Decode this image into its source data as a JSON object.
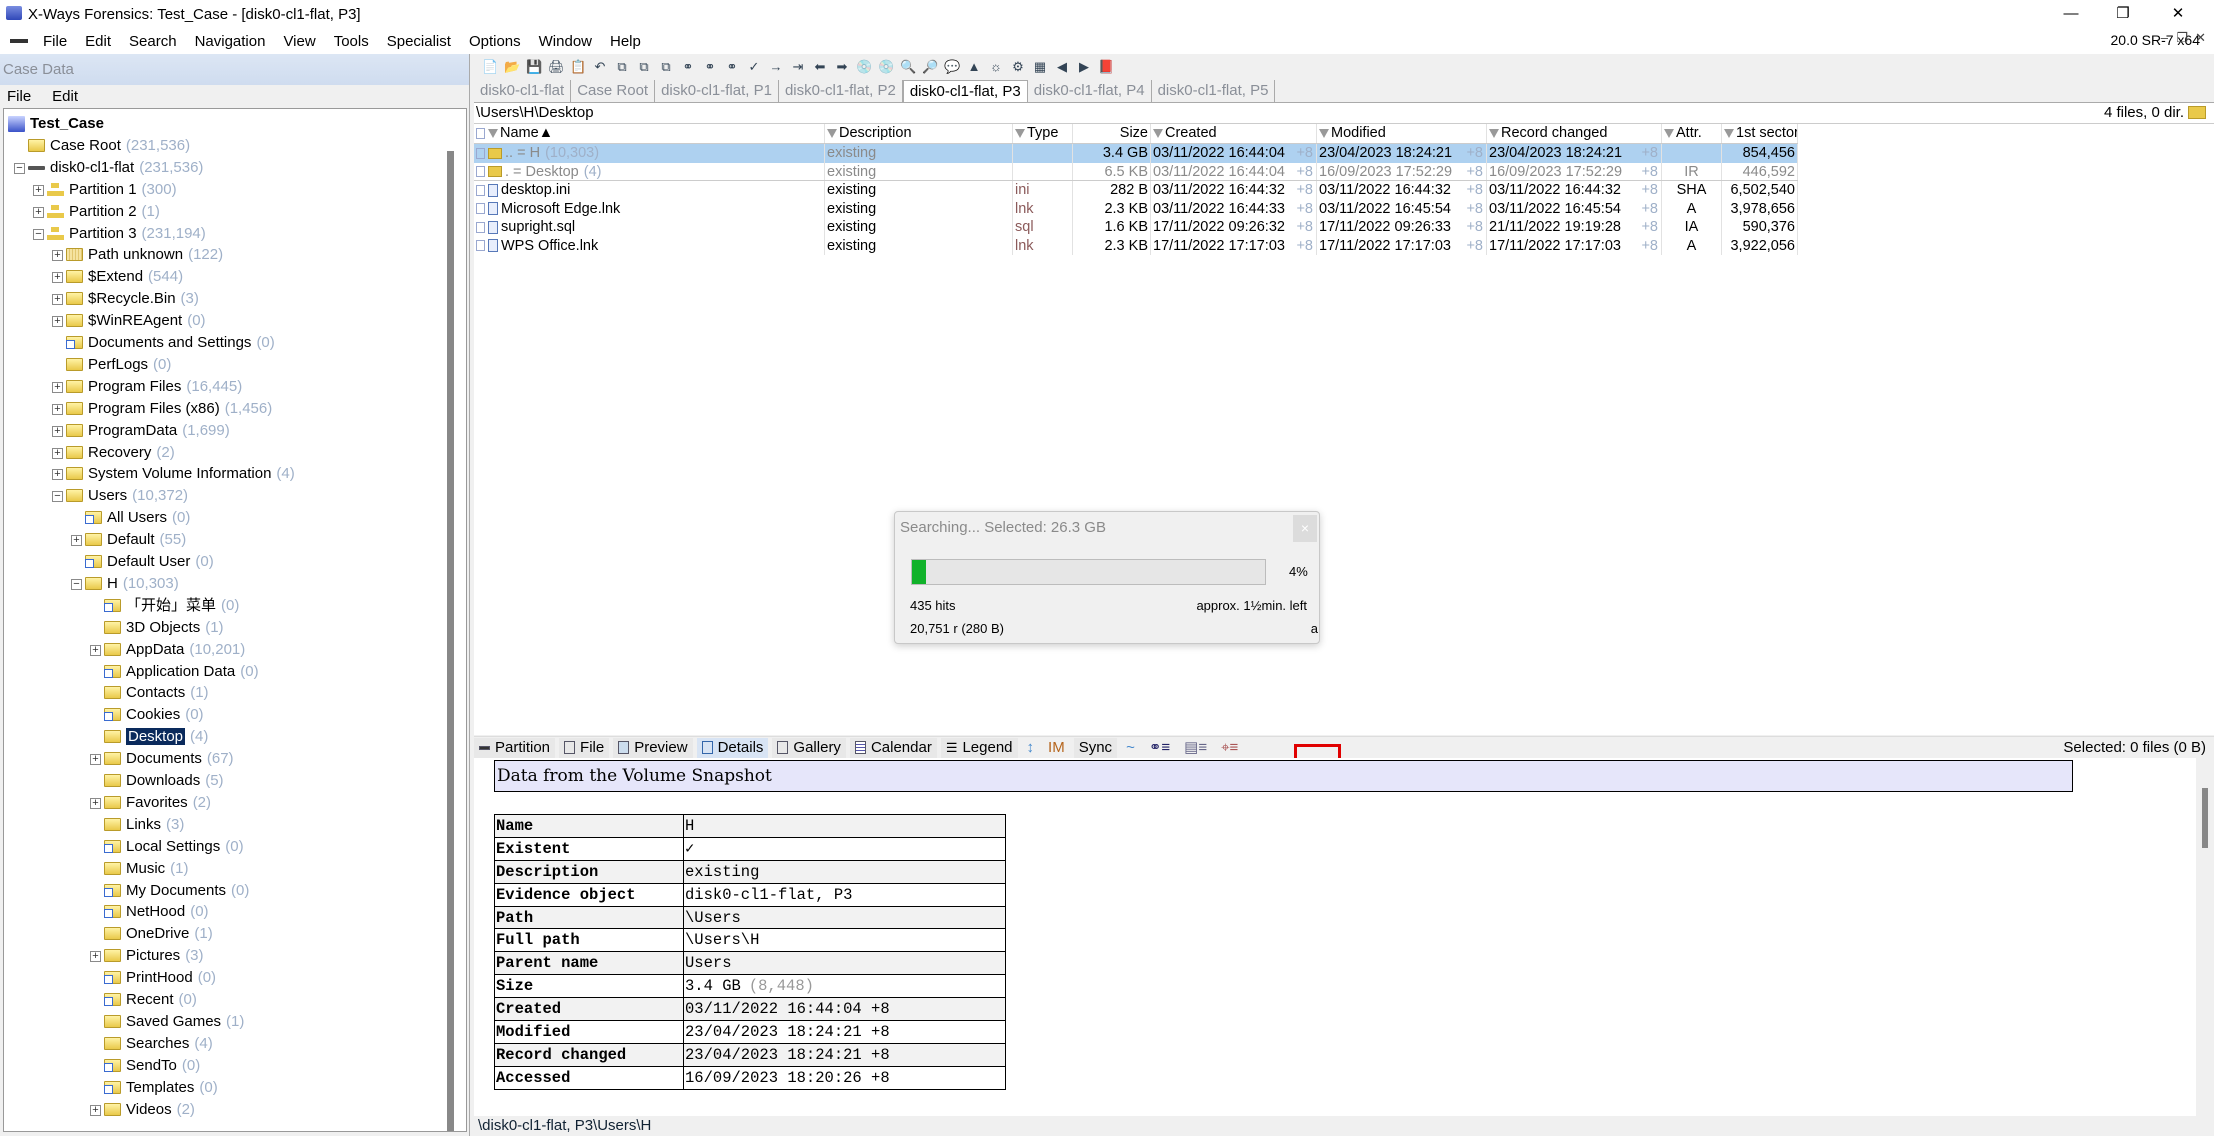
{
  "window": {
    "title": "X-Ways Forensics: Test_Case - [disk0-cl1-flat, P3]",
    "version": "20.0 SR-7 x64"
  },
  "menu": [
    "File",
    "Edit",
    "Search",
    "Navigation",
    "View",
    "Tools",
    "Specialist",
    "Options",
    "Window",
    "Help"
  ],
  "left_pane": {
    "header": "Case Data",
    "menu": [
      "File",
      "Edit"
    ],
    "tree": [
      {
        "label": "Test_Case",
        "count": "",
        "level": 0,
        "exp": "",
        "icon": "case",
        "bold": true
      },
      {
        "label": "Case Root",
        "count": "(231,536)",
        "level": 1,
        "exp": "",
        "icon": "folder"
      },
      {
        "label": "disk0-cl1-flat",
        "count": "(231,536)",
        "level": 1,
        "exp": "-",
        "icon": "disk"
      },
      {
        "label": "Partition 1",
        "count": "(300)",
        "level": 2,
        "exp": "+",
        "icon": "part"
      },
      {
        "label": "Partition 2",
        "count": "(1)",
        "level": 2,
        "exp": "+",
        "icon": "part"
      },
      {
        "label": "Partition 3",
        "count": "(231,194)",
        "level": 2,
        "exp": "-",
        "icon": "part"
      },
      {
        "label": "Path unknown",
        "count": "(122)",
        "level": 3,
        "exp": "+",
        "icon": "unk"
      },
      {
        "label": "$Extend",
        "count": "(544)",
        "level": 3,
        "exp": "+",
        "icon": "folder"
      },
      {
        "label": "$Recycle.Bin",
        "count": "(3)",
        "level": 3,
        "exp": "+",
        "icon": "folder"
      },
      {
        "label": "$WinREAgent",
        "count": "(0)",
        "level": 3,
        "exp": "+",
        "icon": "folder"
      },
      {
        "label": "Documents and Settings",
        "count": "(0)",
        "level": 3,
        "exp": "",
        "icon": "link"
      },
      {
        "label": "PerfLogs",
        "count": "(0)",
        "level": 3,
        "exp": "",
        "icon": "folder"
      },
      {
        "label": "Program Files",
        "count": "(16,445)",
        "level": 3,
        "exp": "+",
        "icon": "folder"
      },
      {
        "label": "Program Files (x86)",
        "count": "(1,456)",
        "level": 3,
        "exp": "+",
        "icon": "folder"
      },
      {
        "label": "ProgramData",
        "count": "(1,699)",
        "level": 3,
        "exp": "+",
        "icon": "folder"
      },
      {
        "label": "Recovery",
        "count": "(2)",
        "level": 3,
        "exp": "+",
        "icon": "folder"
      },
      {
        "label": "System Volume Information",
        "count": "(4)",
        "level": 3,
        "exp": "+",
        "icon": "folder"
      },
      {
        "label": "Users",
        "count": "(10,372)",
        "level": 3,
        "exp": "-",
        "icon": "folder"
      },
      {
        "label": "All Users",
        "count": "(0)",
        "level": 4,
        "exp": "",
        "icon": "link"
      },
      {
        "label": "Default",
        "count": "(55)",
        "level": 4,
        "exp": "+",
        "icon": "folder"
      },
      {
        "label": "Default User",
        "count": "(0)",
        "level": 4,
        "exp": "",
        "icon": "link"
      },
      {
        "label": "H",
        "count": "(10,303)",
        "level": 4,
        "exp": "-",
        "icon": "folder"
      },
      {
        "label": "「开始」菜单",
        "count": "(0)",
        "level": 5,
        "exp": "",
        "icon": "link"
      },
      {
        "label": "3D Objects",
        "count": "(1)",
        "level": 5,
        "exp": "",
        "icon": "folder"
      },
      {
        "label": "AppData",
        "count": "(10,201)",
        "level": 5,
        "exp": "+",
        "icon": "folder"
      },
      {
        "label": "Application Data",
        "count": "(0)",
        "level": 5,
        "exp": "",
        "icon": "link"
      },
      {
        "label": "Contacts",
        "count": "(1)",
        "level": 5,
        "exp": "",
        "icon": "folder"
      },
      {
        "label": "Cookies",
        "count": "(0)",
        "level": 5,
        "exp": "",
        "icon": "link"
      },
      {
        "label": "Desktop",
        "count": "(4)",
        "level": 5,
        "exp": "",
        "icon": "folder",
        "selected": true
      },
      {
        "label": "Documents",
        "count": "(67)",
        "level": 5,
        "exp": "+",
        "icon": "folder"
      },
      {
        "label": "Downloads",
        "count": "(5)",
        "level": 5,
        "exp": "",
        "icon": "folder"
      },
      {
        "label": "Favorites",
        "count": "(2)",
        "level": 5,
        "exp": "+",
        "icon": "folder"
      },
      {
        "label": "Links",
        "count": "(3)",
        "level": 5,
        "exp": "",
        "icon": "folder"
      },
      {
        "label": "Local Settings",
        "count": "(0)",
        "level": 5,
        "exp": "",
        "icon": "link"
      },
      {
        "label": "Music",
        "count": "(1)",
        "level": 5,
        "exp": "",
        "icon": "folder"
      },
      {
        "label": "My Documents",
        "count": "(0)",
        "level": 5,
        "exp": "",
        "icon": "link"
      },
      {
        "label": "NetHood",
        "count": "(0)",
        "level": 5,
        "exp": "",
        "icon": "link"
      },
      {
        "label": "OneDrive",
        "count": "(1)",
        "level": 5,
        "exp": "",
        "icon": "folder"
      },
      {
        "label": "Pictures",
        "count": "(3)",
        "level": 5,
        "exp": "+",
        "icon": "folder"
      },
      {
        "label": "PrintHood",
        "count": "(0)",
        "level": 5,
        "exp": "",
        "icon": "link"
      },
      {
        "label": "Recent",
        "count": "(0)",
        "level": 5,
        "exp": "",
        "icon": "link"
      },
      {
        "label": "Saved Games",
        "count": "(1)",
        "level": 5,
        "exp": "",
        "icon": "folder"
      },
      {
        "label": "Searches",
        "count": "(4)",
        "level": 5,
        "exp": "",
        "icon": "folder"
      },
      {
        "label": "SendTo",
        "count": "(0)",
        "level": 5,
        "exp": "",
        "icon": "link"
      },
      {
        "label": "Templates",
        "count": "(0)",
        "level": 5,
        "exp": "",
        "icon": "link"
      },
      {
        "label": "Videos",
        "count": "(2)",
        "level": 5,
        "exp": "+",
        "icon": "folder"
      }
    ]
  },
  "tabs": [
    "disk0-cl1-flat",
    "Case Root",
    "disk0-cl1-flat, P1",
    "disk0-cl1-flat, P2",
    "disk0-cl1-flat, P3",
    "disk0-cl1-flat, P4",
    "disk0-cl1-flat, P5"
  ],
  "active_tab": 4,
  "path": "\\Users\\H\\Desktop",
  "file_count": "4 files, 0 dir.",
  "columns": [
    "Name",
    "Description",
    "Type",
    "Size",
    "Created",
    "Modified",
    "Record changed",
    "Attr.",
    "1st sector"
  ],
  "files": [
    {
      "name": "..  =  H",
      "count": "(10,303)",
      "desc": "existing",
      "type": "",
      "size": "3.4 GB",
      "created": "03/11/2022  16:44:04",
      "modified": "23/04/2023  18:24:21",
      "record": "23/04/2023  18:24:21",
      "tz": "+8",
      "attr": "",
      "sector": "854,456",
      "kind": "parent",
      "selected": true
    },
    {
      "name": ".  =  Desktop",
      "count": "(4)",
      "desc": "existing",
      "type": "",
      "size": "6.5 KB",
      "created": "03/11/2022  16:44:04",
      "modified": "16/09/2023  17:52:29",
      "record": "16/09/2023  17:52:29",
      "tz": "+8",
      "attr": "IR",
      "sector": "446,592",
      "kind": "self"
    },
    {
      "name": "desktop.ini",
      "desc": "existing",
      "type": "ini",
      "size": "282 B",
      "created": "03/11/2022  16:44:32",
      "modified": "03/11/2022  16:44:32",
      "record": "03/11/2022  16:44:32",
      "tz": "+8",
      "attr": "SHA",
      "sector": "6,502,540",
      "kind": "file"
    },
    {
      "name": "Microsoft Edge.lnk",
      "desc": "existing",
      "type": "lnk",
      "size": "2.3 KB",
      "created": "03/11/2022  16:44:33",
      "modified": "03/11/2022  16:45:54",
      "record": "03/11/2022  16:45:54",
      "tz": "+8",
      "attr": "A",
      "sector": "3,978,656",
      "kind": "file"
    },
    {
      "name": "supright.sql",
      "desc": "existing",
      "type": "sql",
      "size": "1.6 KB",
      "created": "17/11/2022  09:26:32",
      "modified": "17/11/2022  09:26:33",
      "record": "21/11/2022  19:19:28",
      "tz": "+8",
      "attr": "IA",
      "sector": "590,376",
      "kind": "file"
    },
    {
      "name": "WPS Office.lnk",
      "desc": "existing",
      "type": "lnk",
      "size": "2.3 KB",
      "created": "17/11/2022  17:17:03",
      "modified": "17/11/2022  17:17:03",
      "record": "17/11/2022  17:17:03",
      "tz": "+8",
      "attr": "A",
      "sector": "3,922,056",
      "kind": "file"
    }
  ],
  "search_dialog": {
    "title": "Searching... Selected: 26.3 GB",
    "progress_percent": 4,
    "progress_label": "4%",
    "hits": "435 hits",
    "time_left": "approx. 1½min. left",
    "position": "20,751  r (280 B)",
    "trailing": "a",
    "close": "×",
    "bar_color": "#11b22a"
  },
  "bottom_toolbar": {
    "buttons": [
      "Partition",
      "File",
      "Preview",
      "Details",
      "Gallery",
      "Calendar",
      "Legend"
    ],
    "im": "IM",
    "sync": "Sync",
    "selected": "Selected: 0 files (0 B)"
  },
  "details": {
    "heading": "Data from the Volume Snapshot",
    "rows": [
      {
        "k": "Name",
        "v": "H"
      },
      {
        "k": "Existent",
        "v": "✓"
      },
      {
        "k": "Description",
        "v": "existing"
      },
      {
        "k": "Evidence object",
        "v": "disk0-cl1-flat, P3"
      },
      {
        "k": "Path",
        "v": "\\Users"
      },
      {
        "k": "Full path",
        "v": "\\Users\\H"
      },
      {
        "k": "Parent name",
        "v": "Users"
      },
      {
        "k": "Size",
        "v": "3.4 GB",
        "extra": "(8,448)"
      },
      {
        "k": "Created",
        "v": "03/11/2022   16:44:04   +8"
      },
      {
        "k": "Modified",
        "v": "23/04/2023   18:24:21   +8"
      },
      {
        "k": "Record changed",
        "v": "23/04/2023   18:24:21   +8"
      },
      {
        "k": "Accessed",
        "v": "16/09/2023   18:20:26   +8"
      }
    ]
  },
  "status_path": "\\disk0-cl1-flat, P3\\Users\\H"
}
